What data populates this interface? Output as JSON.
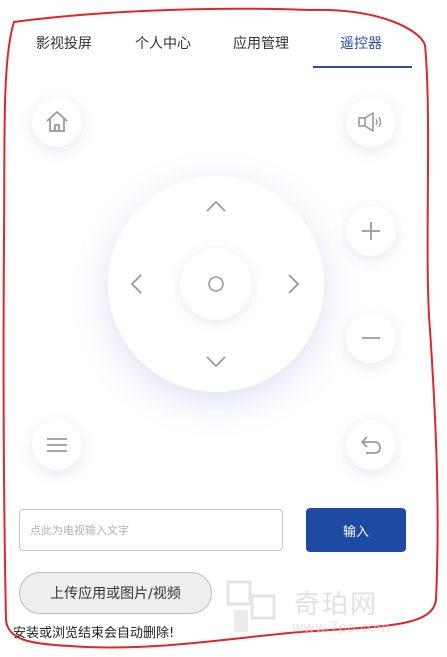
{
  "tabs": [
    {
      "label": "影视投屏",
      "active": false
    },
    {
      "label": "个人中心",
      "active": false
    },
    {
      "label": "应用管理",
      "active": false
    },
    {
      "label": "遥控器",
      "active": true
    }
  ],
  "colors": {
    "accent": "#2b4fa0",
    "primary_button": "#1e4aa3",
    "annotation_outline": "#e0262a",
    "icon_gray": "#9a9a9a"
  },
  "remote": {
    "home_icon": "home-icon",
    "volume_icon": "speaker-icon",
    "menu_icon": "hamburger-menu-icon",
    "back_icon": "back-arrow-icon",
    "volume_up_symbol": "+",
    "volume_down_symbol": "−"
  },
  "text_input": {
    "placeholder": "点此为电视输入文字",
    "value": ""
  },
  "input_button": {
    "label": "输入"
  },
  "upload_button": {
    "label": "上传应用或图片/视频"
  },
  "notice": "安装或浏览结束会自动删除!",
  "watermark": {
    "name": "奇珀网",
    "url": "www.7po.com"
  }
}
